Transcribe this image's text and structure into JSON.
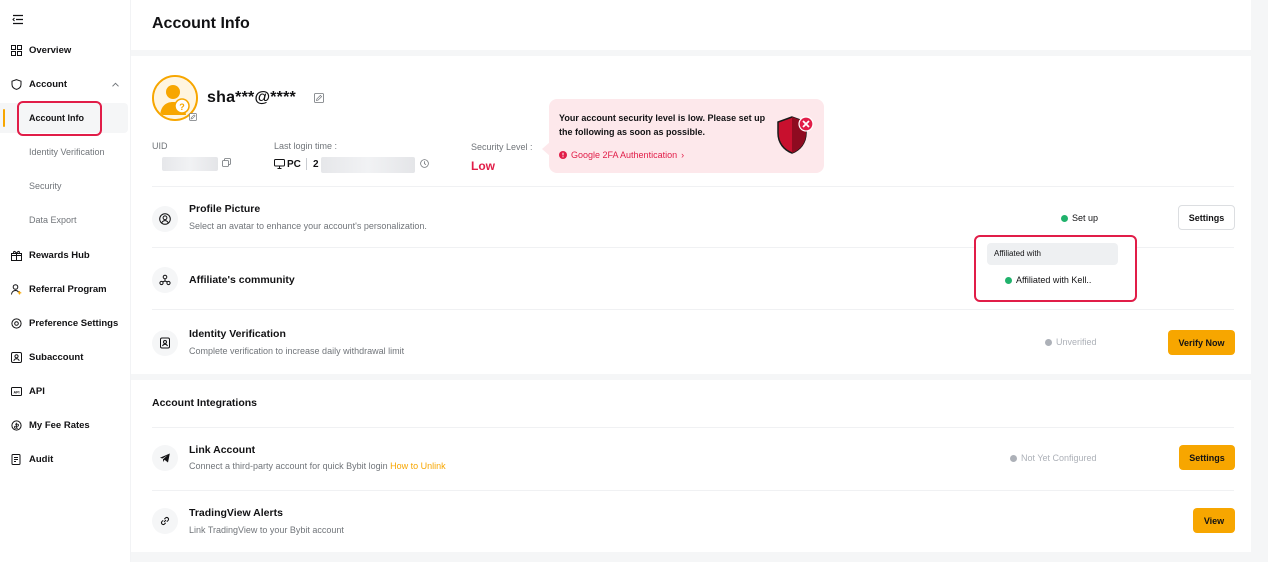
{
  "sidebar": {
    "items": [
      {
        "label": "Overview",
        "icon": "grid-icon"
      },
      {
        "label": "Account",
        "icon": "shield-icon"
      },
      {
        "label": "Rewards Hub",
        "icon": "gift-icon"
      },
      {
        "label": "Referral Program",
        "icon": "person-plus-icon"
      },
      {
        "label": "Preference Settings",
        "icon": "gear-icon"
      },
      {
        "label": "Subaccount",
        "icon": "subaccount-icon"
      },
      {
        "label": "API",
        "icon": "api-icon"
      },
      {
        "label": "My Fee Rates",
        "icon": "coin-icon"
      },
      {
        "label": "Audit",
        "icon": "audit-icon"
      }
    ],
    "account_sub": [
      {
        "label": "Account Info",
        "active": true
      },
      {
        "label": "Identity Verification"
      },
      {
        "label": "Security"
      },
      {
        "label": "Data Export"
      }
    ]
  },
  "header": {
    "title": "Account Info"
  },
  "profile": {
    "username": "sha***@****",
    "uid_label": "UID",
    "last_login_label": "Last login time :",
    "last_login_device": "PC",
    "last_login_prefix": "2",
    "security_label": "Security Level :",
    "security_value": "Low"
  },
  "security_popup": {
    "message": "Your account security level is low. Please set up the following as soon as possible.",
    "link": "Google 2FA Authentication",
    "link_arrow": "›"
  },
  "rows": {
    "profile_picture": {
      "title": "Profile Picture",
      "desc": "Select an avatar to enhance your account's personalization.",
      "status": "Set up",
      "button": "Settings"
    },
    "affiliate": {
      "title": "Affiliate's community",
      "tooltip": "Affiliated with",
      "status": "Affiliated with Kell.."
    },
    "identity": {
      "title": "Identity Verification",
      "desc": "Complete verification to increase daily withdrawal limit",
      "status": "Unverified",
      "button": "Verify Now"
    }
  },
  "integrations": {
    "title": "Account Integrations",
    "link_account": {
      "title": "Link Account",
      "desc": "Connect a third-party account for quick Bybit login",
      "desc_link": "How to Unlink",
      "status": "Not Yet Configured",
      "button": "Settings"
    },
    "tradingview": {
      "title": "TradingView Alerts",
      "desc": "Link TradingView to your Bybit account",
      "button": "View"
    }
  },
  "colors": {
    "accent": "#f7a600",
    "danger": "#e11d48",
    "success": "#20b26c",
    "muted": "#adb1b8"
  }
}
